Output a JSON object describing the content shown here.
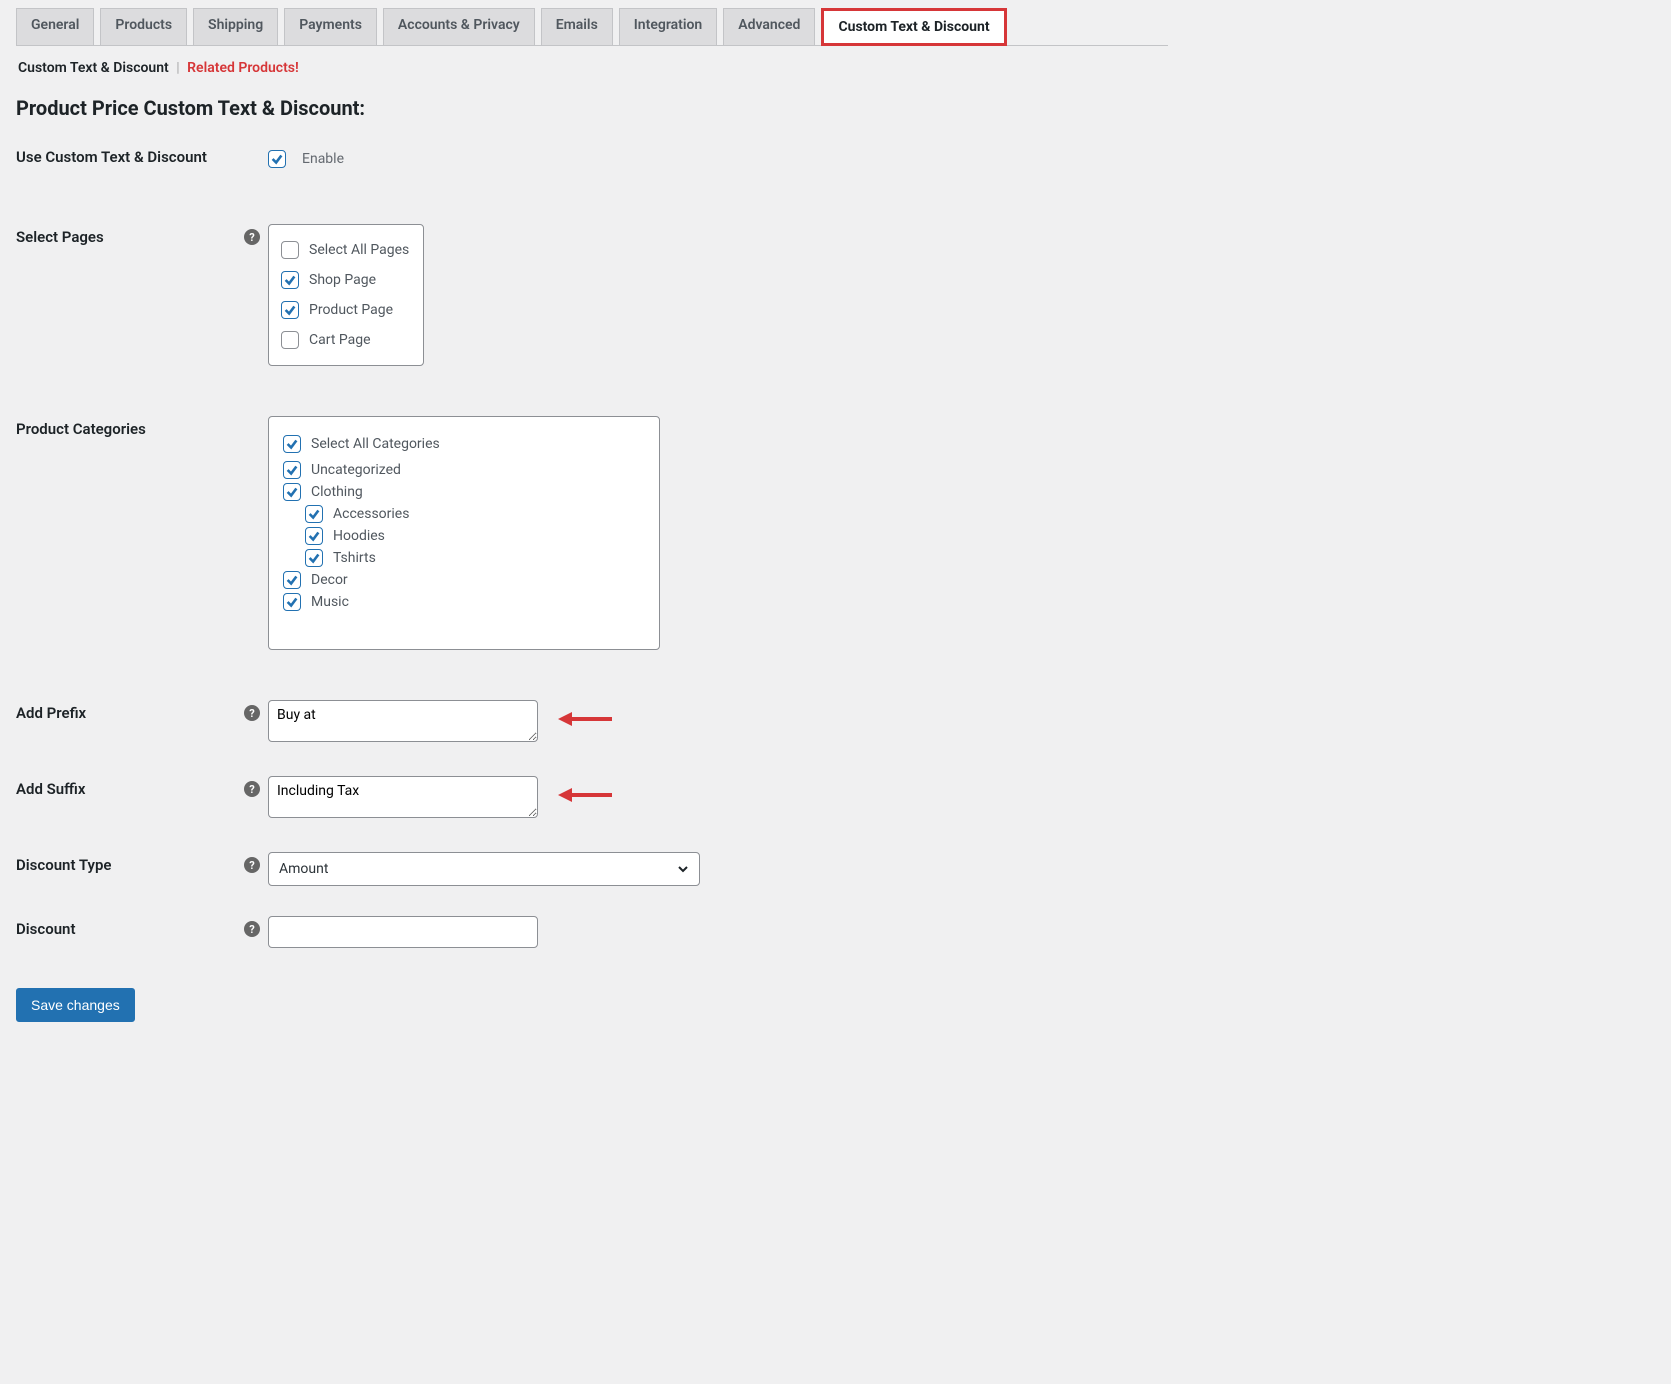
{
  "tabs": {
    "items": [
      {
        "label": "General"
      },
      {
        "label": "Products"
      },
      {
        "label": "Shipping"
      },
      {
        "label": "Payments"
      },
      {
        "label": "Accounts & Privacy"
      },
      {
        "label": "Emails"
      },
      {
        "label": "Integration"
      },
      {
        "label": "Advanced"
      },
      {
        "label": "Custom Text & Discount"
      }
    ]
  },
  "subnav": {
    "current": "Custom Text & Discount",
    "separator": "|",
    "related": "Related Products!"
  },
  "section_title": "Product Price Custom Text & Discount:",
  "fields": {
    "use_custom": {
      "label": "Use Custom Text & Discount",
      "enable_text": "Enable",
      "checked": true
    },
    "select_pages": {
      "label": "Select Pages",
      "options": [
        {
          "label": "Select All Pages",
          "checked": false
        },
        {
          "label": "Shop Page",
          "checked": true
        },
        {
          "label": "Product Page",
          "checked": true
        },
        {
          "label": "Cart Page",
          "checked": false
        }
      ]
    },
    "product_categories": {
      "label": "Product Categories",
      "options": [
        {
          "label": "Select All Categories",
          "checked": true,
          "indent": 0
        },
        {
          "label": "Uncategorized",
          "checked": true,
          "indent": 0
        },
        {
          "label": "Clothing",
          "checked": true,
          "indent": 0
        },
        {
          "label": "Accessories",
          "checked": true,
          "indent": 1
        },
        {
          "label": "Hoodies",
          "checked": true,
          "indent": 1
        },
        {
          "label": "Tshirts",
          "checked": true,
          "indent": 1
        },
        {
          "label": "Decor",
          "checked": true,
          "indent": 0
        },
        {
          "label": "Music",
          "checked": true,
          "indent": 0
        }
      ]
    },
    "add_prefix": {
      "label": "Add Prefix",
      "value": "Buy at"
    },
    "add_suffix": {
      "label": "Add Suffix",
      "value": "Including Tax"
    },
    "discount_type": {
      "label": "Discount Type",
      "value": "Amount"
    },
    "discount": {
      "label": "Discount",
      "value": ""
    }
  },
  "save_button": "Save changes",
  "help_char": "?"
}
